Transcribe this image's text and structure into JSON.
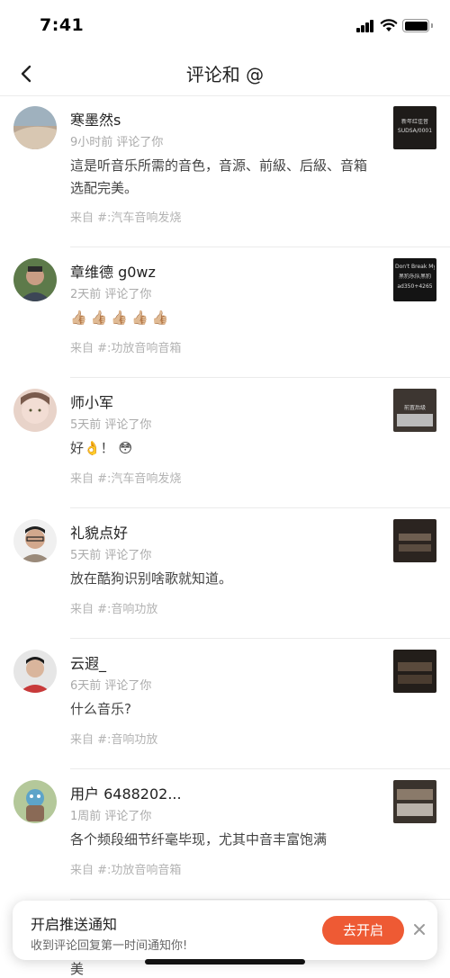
{
  "status": {
    "time": "7:41"
  },
  "nav": {
    "title": "评论和 @"
  },
  "comments": [
    {
      "name": "寒墨然s",
      "meta": "9小时前 评论了你",
      "content": "這是听音乐所需的音色，音源、前級、后級、音箱选配完美。",
      "source": "来自 #:汽车音响发烧",
      "thumb_text": [
        "新年红佳音",
        "SUDSA/0001"
      ]
    },
    {
      "name": "章维德 g0wz",
      "meta": "2天前 评论了你",
      "content": "",
      "emoji": [
        "👍🏼",
        "👍🏼",
        "👍🏼",
        "👍🏼",
        "👍🏼"
      ],
      "source": "来自 #:功放音响音箱",
      "thumb_text": [
        "Don't Break My Heart",
        "黑豹乐队黑豹",
        "ad350+4265"
      ]
    },
    {
      "name": "师小军",
      "meta": "5天前 评论了你",
      "content": "好👌！ 😳",
      "source": "来自 #:汽车音响发烧",
      "thumb_text": [
        "前置后级"
      ]
    },
    {
      "name": "礼貌点好",
      "meta": "5天前 评论了你",
      "content": "放在酷狗识别啥歌就知道。",
      "source": "来自 #:音响功放",
      "thumb_text": []
    },
    {
      "name": "云遐_",
      "meta": "6天前 评论了你",
      "content": "什么音乐?",
      "source": "来自 #:音响功放",
      "thumb_text": []
    },
    {
      "name": "用户 6488202...",
      "meta": "1周前 评论了你",
      "content": "各个频段细节纤毫毕现，尤其中音丰富饱满",
      "source": "来自 #:功放音响音箱",
      "thumb_text": []
    }
  ],
  "peek_text": "美",
  "toast": {
    "title": "开启推送通知",
    "subtitle": "收到评论回复第一时间通知你!",
    "button": "去开启",
    "close": "✕"
  },
  "colors": {
    "accent": "#ee5a34"
  }
}
